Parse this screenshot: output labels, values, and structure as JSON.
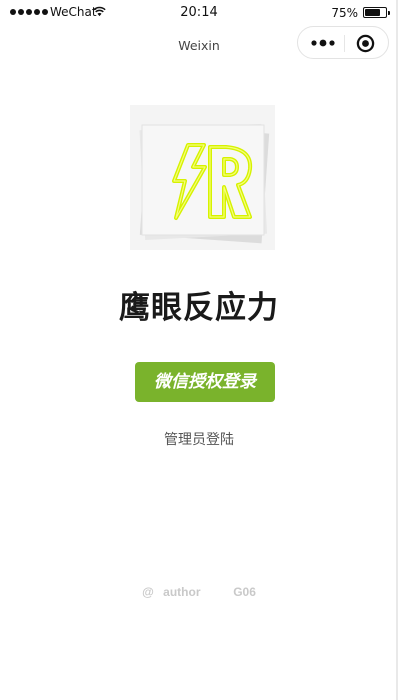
{
  "status_bar": {
    "carrier": "WeChat",
    "time": "20:14",
    "battery_percent": "75%",
    "battery_level": 0.75,
    "wifi_icon": "wifi-icon",
    "battery_icon": "battery-icon"
  },
  "nav": {
    "title": "Weixin",
    "menu_icon": "more-dots-icon",
    "close_icon": "circle-close-icon"
  },
  "main": {
    "logo_icon": "lightning-r-logo",
    "title": "鹰眼反应力",
    "wechat_login_label": "微信授权登录",
    "admin_login_label": "管理员登陆"
  },
  "footer": {
    "at": "@",
    "author": "author",
    "team": "G06"
  },
  "colors": {
    "accent_green": "#7ab32c",
    "logo_yellow": "#e8ff2a"
  }
}
